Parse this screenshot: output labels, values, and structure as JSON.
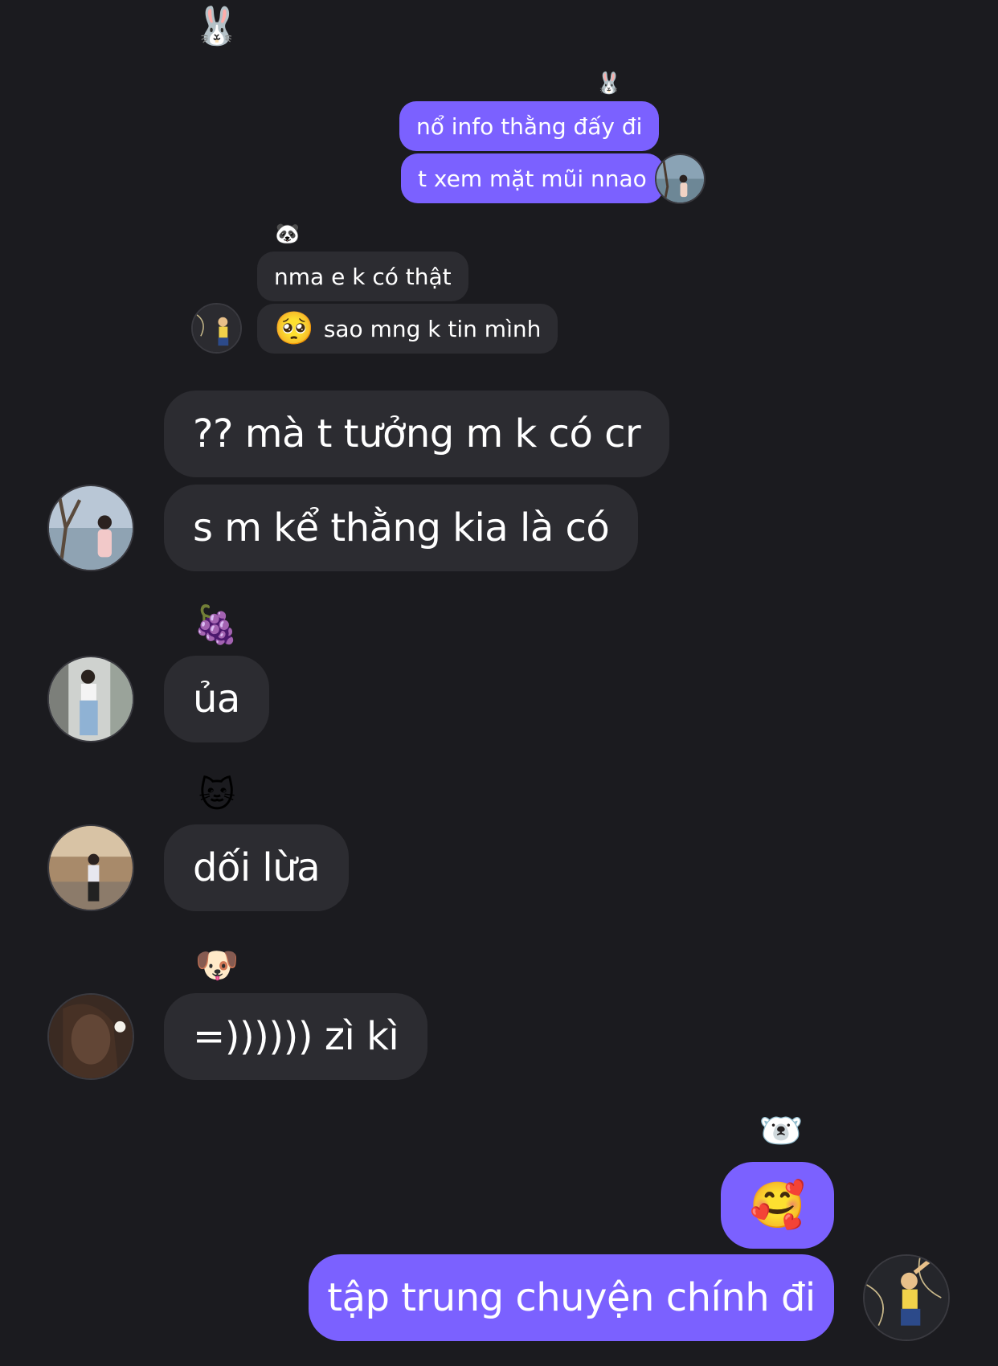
{
  "theme": {
    "background": "#1b1b1f",
    "incoming_bubble": "#2c2c31",
    "outgoing_bubble": "#7b61ff",
    "text": "#ffffff"
  },
  "thread": {
    "top_sticker": "🐰",
    "group1": {
      "sender_badge": "🐰",
      "messages": [
        "nổ info thằng đấy đi",
        "t xem mặt mũi nnao"
      ]
    },
    "group2": {
      "sender_badge": "🐼",
      "messages": [
        "nma e k có thật",
        "sao mng k tin mình"
      ],
      "inline_emoji": "🥺"
    },
    "group3": {
      "messages": [
        "?? mà t tưởng m k có cr",
        "s m kể thằng kia là có"
      ]
    },
    "group4": {
      "sender_badge": "🍇",
      "messages": [
        "ủa"
      ]
    },
    "group5": {
      "sender_badge": "🐱",
      "messages": [
        "dối lừa"
      ]
    },
    "group6": {
      "sender_badge": "🐶",
      "messages": [
        "=)))))) zì kì"
      ]
    },
    "group7": {
      "sender_badge": "🐻‍❄️",
      "messages": [
        "🥰",
        "tập trung chuyện chính đi"
      ]
    }
  }
}
